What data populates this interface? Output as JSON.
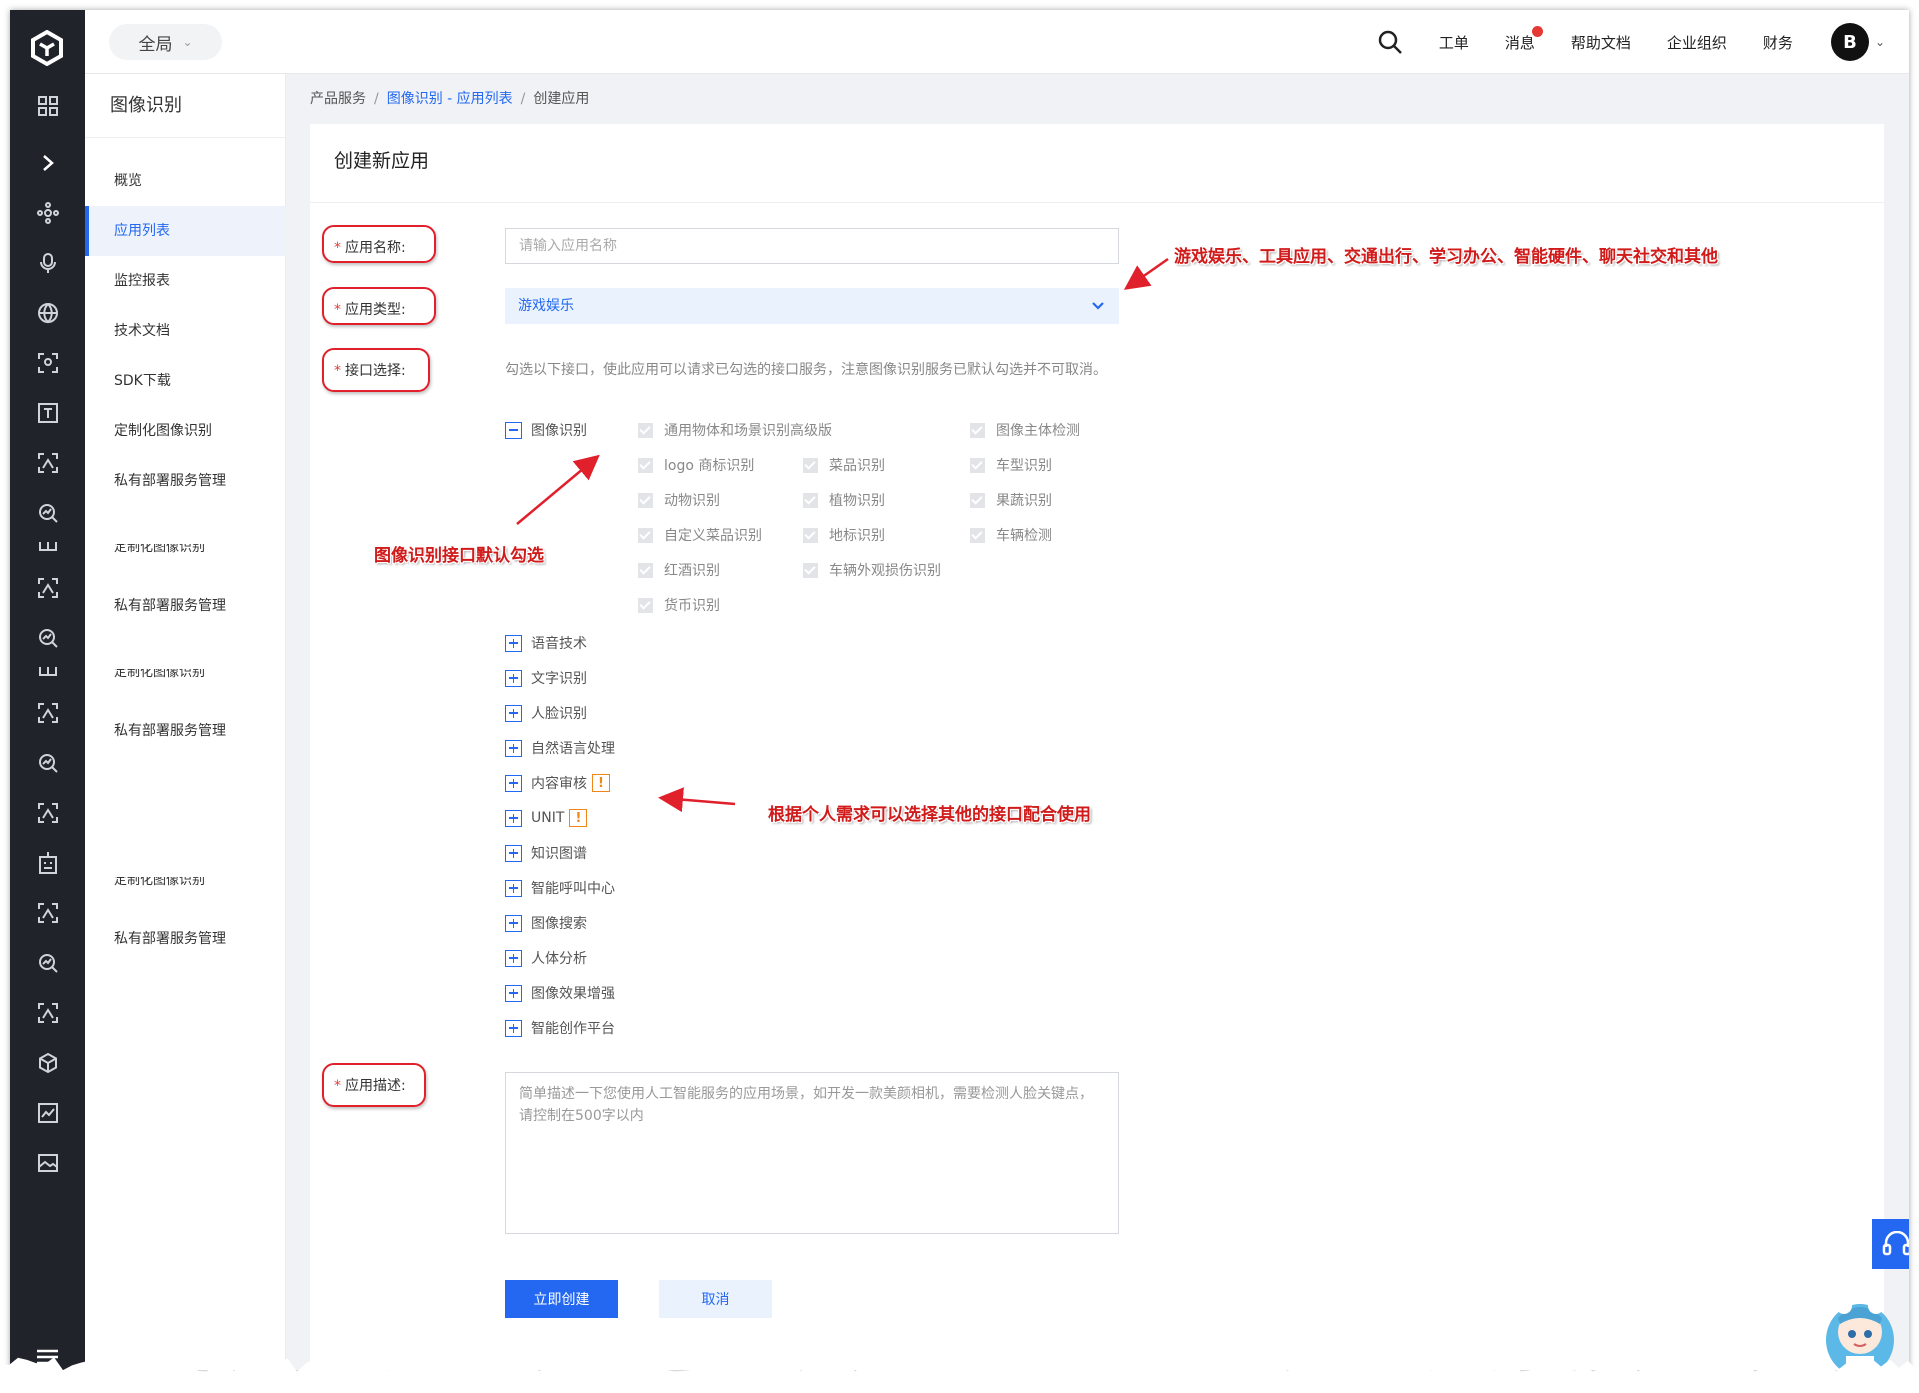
{
  "topbar": {
    "scope": "全局",
    "nav": [
      "工单",
      "消息",
      "帮助文档",
      "企业组织",
      "财务"
    ],
    "avatar_letter": "B"
  },
  "sidebar": {
    "title": "图像识别",
    "items": [
      "概览",
      "应用列表",
      "监控报表",
      "技术文档",
      "SDK下载",
      "定制化图像识别",
      "私有部署服务管理"
    ],
    "ghost_items": [
      "定制化图像识别",
      "私有部署服务管理",
      "定制化图像识别",
      "私有部署服务管理",
      "定制化图像识别",
      "私有部署服务管理"
    ]
  },
  "breadcrumb": {
    "root": "产品服务",
    "link": "图像识别 - 应用列表",
    "current": "创建应用",
    "separator": "/"
  },
  "form": {
    "title": "创建新应用",
    "required_mark": "*",
    "name_label": "应用名称:",
    "name_placeholder": "请输入应用名称",
    "type_label": "应用类型:",
    "type_value": "游戏娱乐",
    "api_label": "接口选择:",
    "api_hint": "勾选以下接口，使此应用可以请求已勾选的接口服务，注意图像识别服务已默认勾选并不可取消。",
    "api_group_expanded": "图像识别",
    "api_options": [
      "通用物体和场景识别高级版",
      "图像主体检测",
      "logo 商标识别",
      "菜品识别",
      "车型识别",
      "动物识别",
      "植物识别",
      "果蔬识别",
      "自定义菜品识别",
      "地标识别",
      "车辆检测",
      "红酒识别",
      "车辆外观损伤识别",
      "货币识别"
    ],
    "api_groups_collapsed": [
      "语音技术",
      "文字识别",
      "人脸识别",
      "自然语言处理",
      "内容审核",
      "UNIT",
      "知识图谱",
      "智能呼叫中心",
      "图像搜索",
      "人体分析",
      "图像效果增强",
      "智能创作平台"
    ],
    "warn_symbol": "!",
    "desc_label": "应用描述:",
    "desc_placeholder": "简单描述一下您使用人工智能服务的应用场景，如开发一款美颜相机，需要检测人脸关键点，请控制在500字以内",
    "submit": "立即创建",
    "cancel": "取消"
  },
  "annotations": {
    "types": "游戏娱乐、工具应用、交通出行、学习办公、智能硬件、聊天社交和其他",
    "default_checked": "图像识别接口默认勾选",
    "other_apis": "根据个人需求可以选择其他的接口配合使用"
  },
  "colors": {
    "accent": "#2468f2",
    "rail_bg": "#20232a",
    "annotation_red": "#d11a1a",
    "warning_orange": "#f0861a"
  }
}
